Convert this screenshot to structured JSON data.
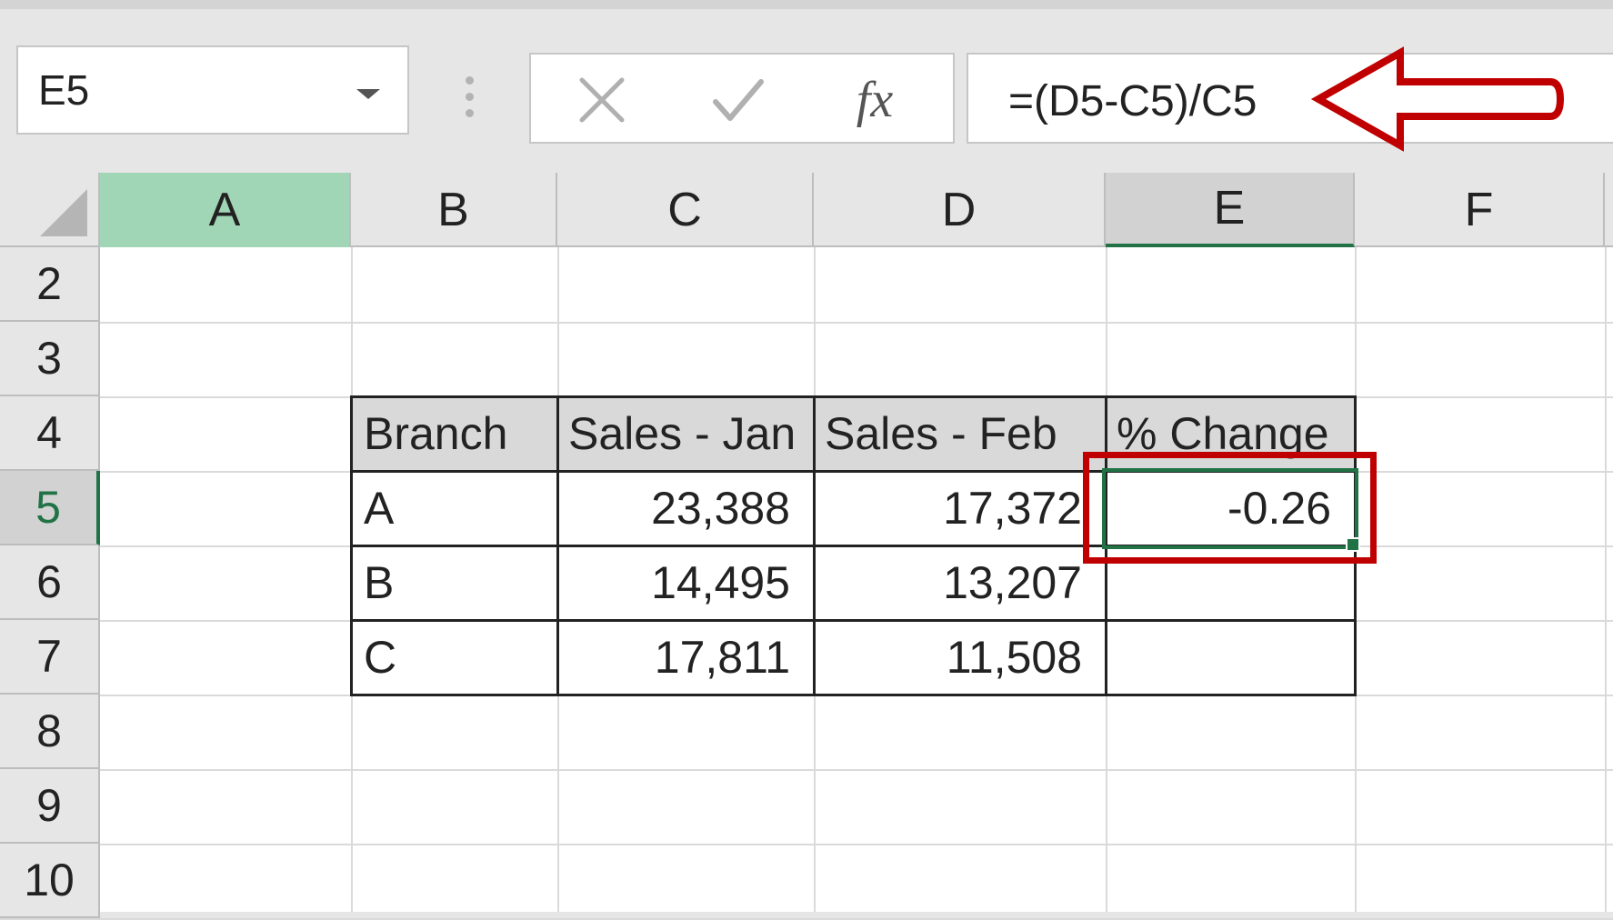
{
  "name_box": {
    "value": "E5"
  },
  "formula_bar": {
    "cancel_icon": "x-icon",
    "enter_icon": "check-icon",
    "insert_function_label": "fx",
    "formula": "=(D5-C5)/C5"
  },
  "columns": [
    "A",
    "B",
    "C",
    "D",
    "E",
    "F"
  ],
  "rows": [
    "2",
    "3",
    "4",
    "5",
    "6",
    "7",
    "8",
    "9",
    "10"
  ],
  "table": {
    "headers": [
      "Branch",
      "Sales - Jan",
      "Sales - Feb",
      "% Change"
    ],
    "rows": [
      {
        "branch": "A",
        "jan": "23,388",
        "feb": "17,372",
        "change": "-0.26"
      },
      {
        "branch": "B",
        "jan": "14,495",
        "feb": "13,207",
        "change": ""
      },
      {
        "branch": "C",
        "jan": "17,811",
        "feb": "11,508",
        "change": ""
      }
    ]
  },
  "selected_cell": "E5",
  "colors": {
    "selection": "#217346",
    "annotation": "#c00000",
    "table_header_bg": "#d9d9d9"
  }
}
